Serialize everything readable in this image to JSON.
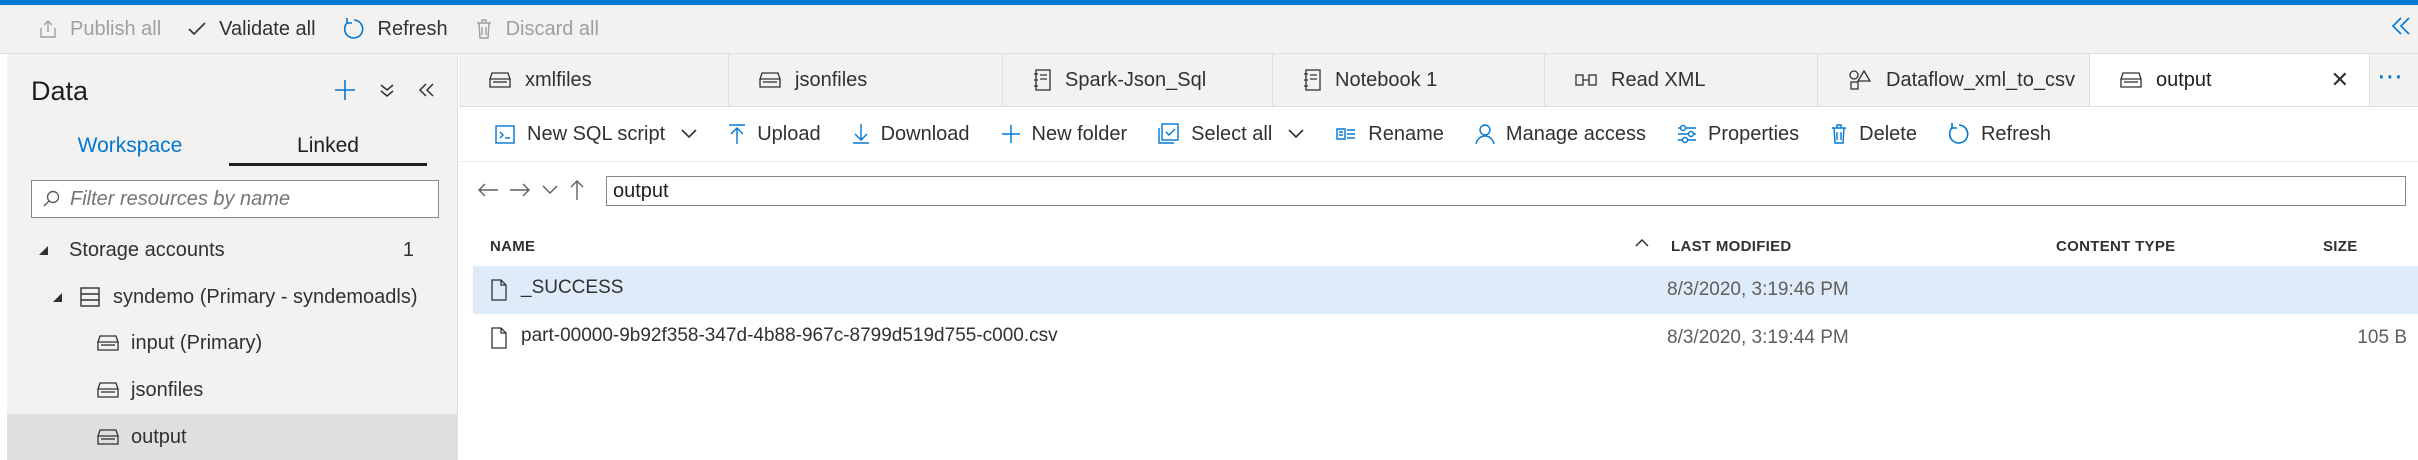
{
  "commandbar": {
    "publish_all": "Publish all",
    "validate_all": "Validate all",
    "refresh": "Refresh",
    "discard_all": "Discard all"
  },
  "data_panel": {
    "title": "Data",
    "tabs": [
      "Workspace",
      "Linked"
    ],
    "filter_placeholder": "Filter resources by name",
    "storage_accounts_label": "Storage accounts",
    "storage_accounts_count": "1",
    "account_label": "syndemo (Primary - syndemoadls)",
    "containers": [
      "input (Primary)",
      "jsonfiles",
      "output"
    ]
  },
  "tabs": [
    {
      "label": "xmlfiles",
      "icon": "container-icon"
    },
    {
      "label": "jsonfiles",
      "icon": "container-icon"
    },
    {
      "label": "Spark-Json_Sql",
      "icon": "notebook-icon"
    },
    {
      "label": "Notebook 1",
      "icon": "notebook-icon"
    },
    {
      "label": "Read XML",
      "icon": "pipeline-icon"
    },
    {
      "label": "Dataflow_xml_to_csv",
      "icon": "dataflow-icon"
    },
    {
      "label": "output",
      "icon": "container-icon"
    }
  ],
  "toolbar": {
    "new_sql_script": "New SQL script",
    "upload": "Upload",
    "download": "Download",
    "new_folder": "New folder",
    "select_all": "Select all",
    "rename": "Rename",
    "manage_access": "Manage access",
    "properties": "Properties",
    "delete": "Delete",
    "refresh": "Refresh"
  },
  "path": {
    "value": "output"
  },
  "table": {
    "headers": {
      "name": "NAME",
      "last_modified": "LAST MODIFIED",
      "content_type": "CONTENT TYPE",
      "size": "SIZE"
    },
    "rows": [
      {
        "name": "_SUCCESS",
        "last_modified": "8/3/2020, 3:19:46 PM",
        "size": ""
      },
      {
        "name": "part-00000-9b92f358-347d-4b88-967c-8799d519d755-c000.csv",
        "last_modified": "8/3/2020, 3:19:44 PM",
        "size": "105 B"
      }
    ]
  },
  "colors": {
    "accent": "#0078d4",
    "selected_row": "#deecf9",
    "panel_bg": "#f3f2f1"
  }
}
